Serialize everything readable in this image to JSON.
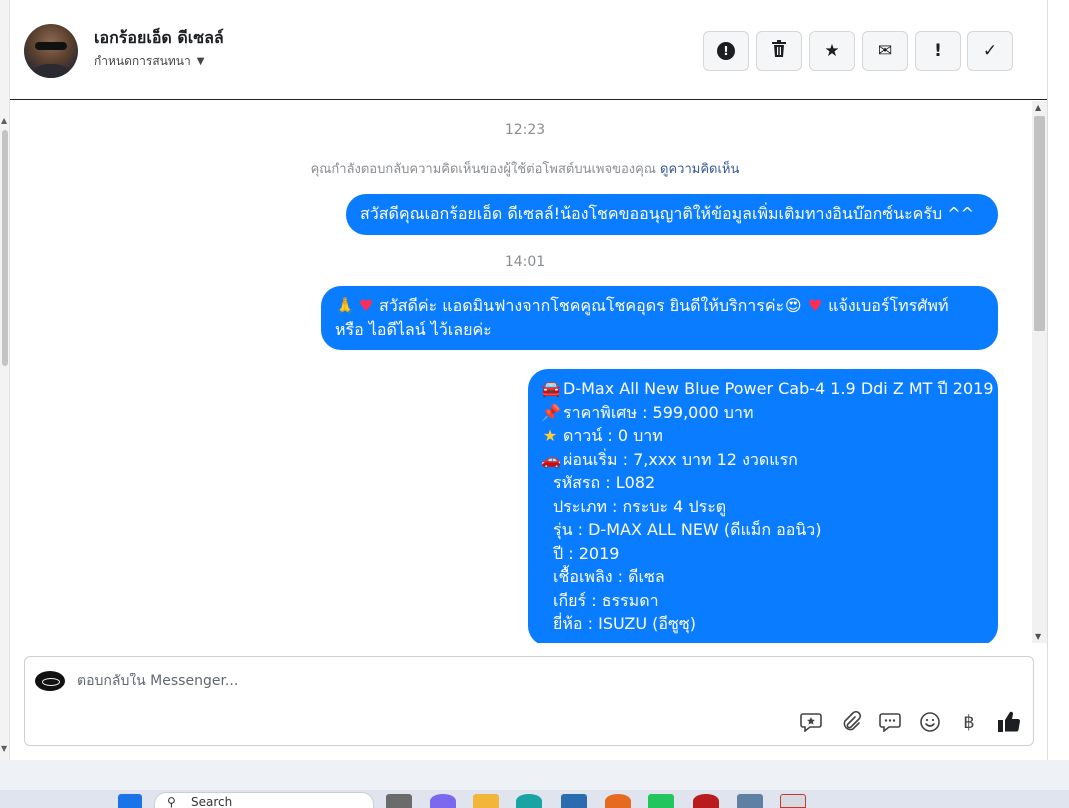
{
  "header": {
    "contact_name": "เอกร้อยเอ็ด ดีเซลล์",
    "conversation_setting": "กำหนดการสนทนา",
    "actions": [
      {
        "name": "report-button",
        "icon": "alert-circle-icon",
        "glyph": "!"
      },
      {
        "name": "delete-button",
        "icon": "trash-icon",
        "glyph": "🗑"
      },
      {
        "name": "star-button",
        "icon": "star-icon",
        "glyph": "★"
      },
      {
        "name": "mark-unread-button",
        "icon": "envelope-icon",
        "glyph": "✉"
      },
      {
        "name": "spam-button",
        "icon": "exclamation-icon",
        "glyph": "!"
      },
      {
        "name": "done-button",
        "icon": "checkmark-icon",
        "glyph": "✓"
      }
    ]
  },
  "messages": {
    "time_1": "12:23",
    "reply_note": "คุณกำลังตอบกลับความคิดเห็นของผู้ใช้ต่อโพสต์บนเพจของคุณ",
    "reply_note_link": "ดูความคิดเห็น",
    "bubble_1": "สวัสดีคุณเอกร้อยเอ็ด ดีเซลล์!น้องโชคขออนุญาติให้ข้อมูลเพิ่มเติมทางอินบ๊อกซ์นะครับ ^^",
    "time_2": "14:01",
    "bubble_2_line1": "สวัสดีค่ะ แอดมินฟางจากโชคคูณโชคอุดร ยินดีให้บริการค่ะ",
    "bubble_2_line1b": "แจ้งเบอร์โทรศัพท์",
    "bubble_2_line2": "หรือ ไอดีไลน์  ไว้เลยค่ะ",
    "bubble_3": {
      "model": "D-Max All New Blue Power Cab-4 1.9 Ddi Z MT ปี 2019",
      "price": "ราคาพิเศษ : 599,000 บาท",
      "down": "ดาวน์ : 0 บาท",
      "installment": "ผ่อนเริ่ม : 7,xxx บาท 12 งวดแรก",
      "code": "รหัสรถ : L082",
      "type": "ประเภท : กระบะ 4 ประตู",
      "series": "รุ่น : D-MAX ALL NEW (ดีแม็ก ออนิว)",
      "year": "ปี : 2019",
      "fuel": "เชื้อเพลิง : ดีเซล",
      "gear": "เกียร์ : ธรรมดา",
      "brand": "ยี่ห้อ : ISUZU (อีซูซุ)"
    }
  },
  "composer": {
    "placeholder": "ตอบกลับใน Messenger...",
    "tools": [
      {
        "name": "saved-reply-button",
        "icon": "chat-star-icon",
        "glyph": "✦"
      },
      {
        "name": "attach-button",
        "icon": "paperclip-icon",
        "glyph": "📎"
      },
      {
        "name": "quick-reply-button",
        "icon": "chat-dots-icon",
        "glyph": "💬"
      },
      {
        "name": "emoji-button",
        "icon": "smiley-icon",
        "glyph": "☺"
      },
      {
        "name": "payment-button",
        "icon": "baht-icon",
        "glyph": "฿"
      },
      {
        "name": "like-button",
        "icon": "thumbs-up-icon",
        "glyph": "👍"
      }
    ]
  },
  "taskbar": {
    "search_placeholder": "Search"
  },
  "colors": {
    "bubble": "#0a7cff",
    "link": "#385898",
    "muted": "#8a8d91"
  }
}
